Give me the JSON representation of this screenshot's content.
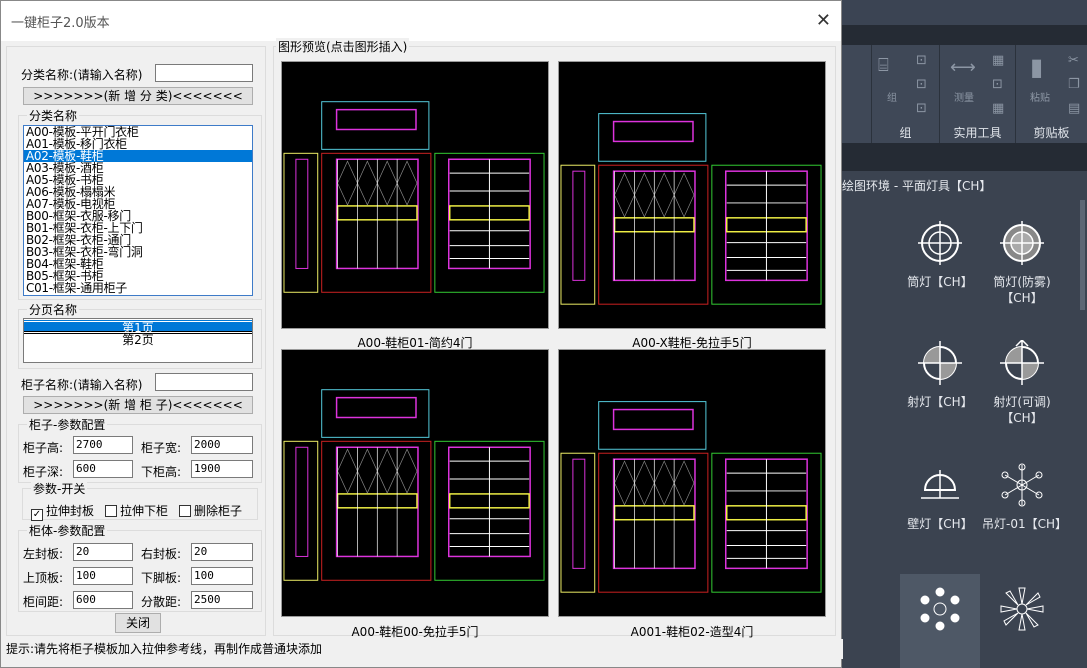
{
  "cad": {
    "ribbon_groups": [
      "组",
      "实用工具",
      "剪贴板"
    ],
    "ribbon_buttons": [
      "组",
      "测量",
      "粘贴"
    ],
    "palette_title": "绘图环境 - 平面灯具【CH】",
    "palette_items": [
      "筒灯【CH】",
      "筒灯(防雾)【CH】",
      "射灯【CH】",
      "射灯(可调)【CH】",
      "壁灯【CH】",
      "吊灯-01【CH】"
    ]
  },
  "dialog": {
    "title": "一键柜子2.0版本",
    "category_name_label": "分类名称:(请输入名称)",
    "category_name_value": "",
    "add_category_button": ">>>>>>>(新 增 分 类)<<<<<<<",
    "category_group_title": "分类名称",
    "categories": [
      "A00-模板-平开门衣柜",
      "A01-模板-移门衣柜",
      "A02-模板-鞋柜",
      "A03-模板-酒柜",
      "A05-模板-书柜",
      "A06-模板-榻榻米",
      "A07-模板-电视柜",
      "B00-框架-衣服-移门",
      "B01-框架-衣柜-上下门",
      "B02-框架-衣柜-通门",
      "B03-框架-衣柜-弯门洞",
      "B04-框架-鞋柜",
      "B05-框架-书柜",
      "C01-框架-通用柜子"
    ],
    "selected_category": "A02-模板-鞋柜",
    "page_group_title": "分页名称",
    "pages": [
      "第1页",
      "第2页"
    ],
    "selected_page": "第1页",
    "cabinet_name_label": "柜子名称:(请输入名称)",
    "cabinet_name_value": "",
    "add_cabinet_button": ">>>>>>>(新 增 柜 子)<<<<<<<",
    "cabinet_params": {
      "title": "柜子-参数配置",
      "height_label": "柜子高:",
      "height": "2700",
      "width_label": "柜子宽:",
      "width": "2000",
      "depth_label": "柜子深:",
      "depth": "600",
      "lower_height_label": "下柜高:",
      "lower_height": "1900"
    },
    "switches": {
      "title": "参数-开关",
      "stretch_panel": "拉伸封板",
      "stretch_panel_checked": true,
      "stretch_lower": "拉伸下柜",
      "stretch_lower_checked": false,
      "delete_cabinet": "删除柜子",
      "delete_cabinet_checked": false
    },
    "body_params": {
      "title": "柜体-参数配置",
      "left_panel_label": "左封板:",
      "left_panel": "20",
      "right_panel_label": "右封板:",
      "right_panel": "20",
      "top_panel_label": "上顶板:",
      "top_panel": "100",
      "foot_panel_label": "下脚板:",
      "foot_panel": "100",
      "spacing_label": "柜间距:",
      "spacing": "600",
      "scatter_label": "分散距:",
      "scatter": "2500"
    },
    "close_button": "关闭",
    "preview_title": "图形预览(点击图形插入)",
    "previews": [
      "A00-鞋柜01-简约4门",
      "A00-X鞋柜-免拉手5门",
      "A00-鞋柜00-免拉手5门",
      "A001-鞋柜02-造型4门"
    ],
    "status": "提示:请先将柜子模板加入拉伸参考线，再制作成普通块添加"
  }
}
